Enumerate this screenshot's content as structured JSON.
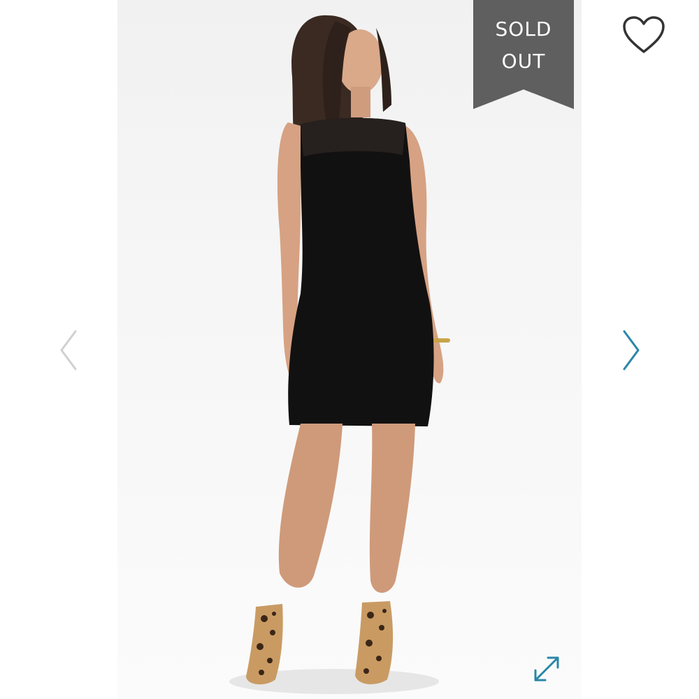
{
  "badge": {
    "line1": "SOLD",
    "line2": "OUT",
    "color": "#5f5f5f"
  },
  "icons": {
    "favorite": "heart-outline-icon",
    "previous": "chevron-left-icon",
    "next": "chevron-right-icon",
    "fullscreen": "expand-arrows-icon"
  },
  "colors": {
    "accent": "#2a86a8",
    "inactive_nav": "#d0d0d0",
    "heart_stroke": "#333333"
  }
}
